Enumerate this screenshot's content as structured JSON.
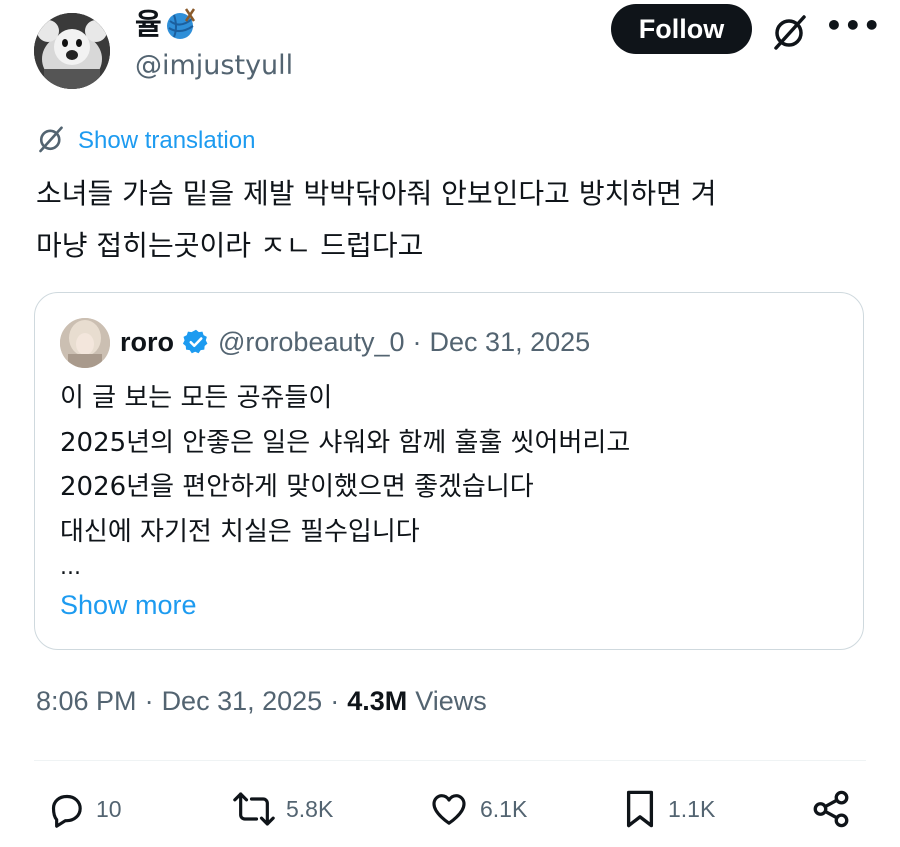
{
  "author": {
    "display_name": "율",
    "name_emoji": "yarn-ball",
    "handle": "@imjustyull"
  },
  "follow_label": "Follow",
  "translation_label": "Show translation",
  "tweet_text": "소녀들 가슴 밑을 제발 박박닦아줘 안보인다고 방치하면 겨\n마냥 접히는곳이라 ㅈㄴ 드럽다고",
  "quote": {
    "name": "roro",
    "verified": true,
    "handle": "@rorobeauty_0",
    "separator": "·",
    "date": "Dec 31, 2025",
    "text": "이 글 보는 모든 공쥬들이\n2025년의 안좋은 일은 샤워와 함께 훌훌 씻어버리고\n2026년을 편안하게 맞이했으면 좋겠습니다\n대신에 자기전 치실은 필수입니다",
    "ellipsis": "...",
    "show_more": "Show more"
  },
  "meta": {
    "time": "8:06 PM",
    "sep1": "·",
    "date": "Dec 31, 2025",
    "sep2": "·",
    "views_count": "4.3M",
    "views_label": "Views"
  },
  "actions": {
    "replies": "10",
    "reposts": "5.8K",
    "likes": "6.1K",
    "bookmarks": "1.1K"
  },
  "colors": {
    "accent": "#1d9bf0",
    "text": "#0f1419",
    "muted": "#536471",
    "follow_bg": "#0f1419",
    "border": "#cfd9de"
  }
}
